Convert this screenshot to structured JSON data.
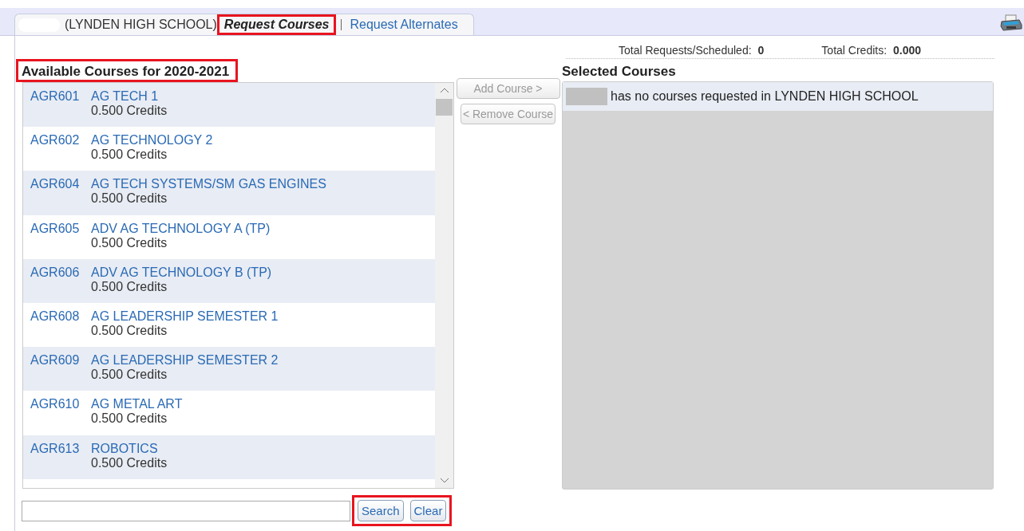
{
  "tabs": [
    {
      "kind": "student",
      "label": "(LYNDEN HIGH SCHOOL)",
      "selected": false
    },
    {
      "kind": "link",
      "label": "Request Courses",
      "selected": true
    },
    {
      "kind": "link",
      "label": "Request Alternates",
      "selected": false
    }
  ],
  "totals": [
    {
      "label": "Total Requests/Scheduled:",
      "value": "0"
    },
    {
      "label": "Total Credits:",
      "value": "0.000"
    }
  ],
  "available": {
    "heading": "Available Courses for 2020-2021",
    "courses": [
      {
        "code": "AGR601",
        "title": "AG TECH 1",
        "credits": "0.500 Credits"
      },
      {
        "code": "AGR602",
        "title": "AG TECHNOLOGY 2",
        "credits": "0.500 Credits"
      },
      {
        "code": "AGR604",
        "title": "AG TECH SYSTEMS/SM GAS ENGINES",
        "credits": "0.500 Credits"
      },
      {
        "code": "AGR605",
        "title": "ADV AG TECHNOLOGY A (TP)",
        "credits": "0.500 Credits"
      },
      {
        "code": "AGR606",
        "title": "ADV AG TECHNOLOGY B (TP)",
        "credits": "0.500 Credits"
      },
      {
        "code": "AGR608",
        "title": "AG LEADERSHIP SEMESTER 1",
        "credits": "0.500 Credits"
      },
      {
        "code": "AGR609",
        "title": "AG LEADERSHIP SEMESTER 2",
        "credits": "0.500 Credits"
      },
      {
        "code": "AGR610",
        "title": "AG METAL ART",
        "credits": "0.500 Credits"
      },
      {
        "code": "AGR613",
        "title": "ROBOTICS",
        "credits": "0.500 Credits"
      }
    ]
  },
  "actions": [
    {
      "label": "Add Course >",
      "disabled": true
    },
    {
      "label": "< Remove Course",
      "disabled": true
    }
  ],
  "selected": {
    "heading": "Selected Courses",
    "message": "has no courses requested in LYNDEN HIGH SCHOOL"
  },
  "search": {
    "buttons": [
      "Search",
      "Clear"
    ]
  }
}
